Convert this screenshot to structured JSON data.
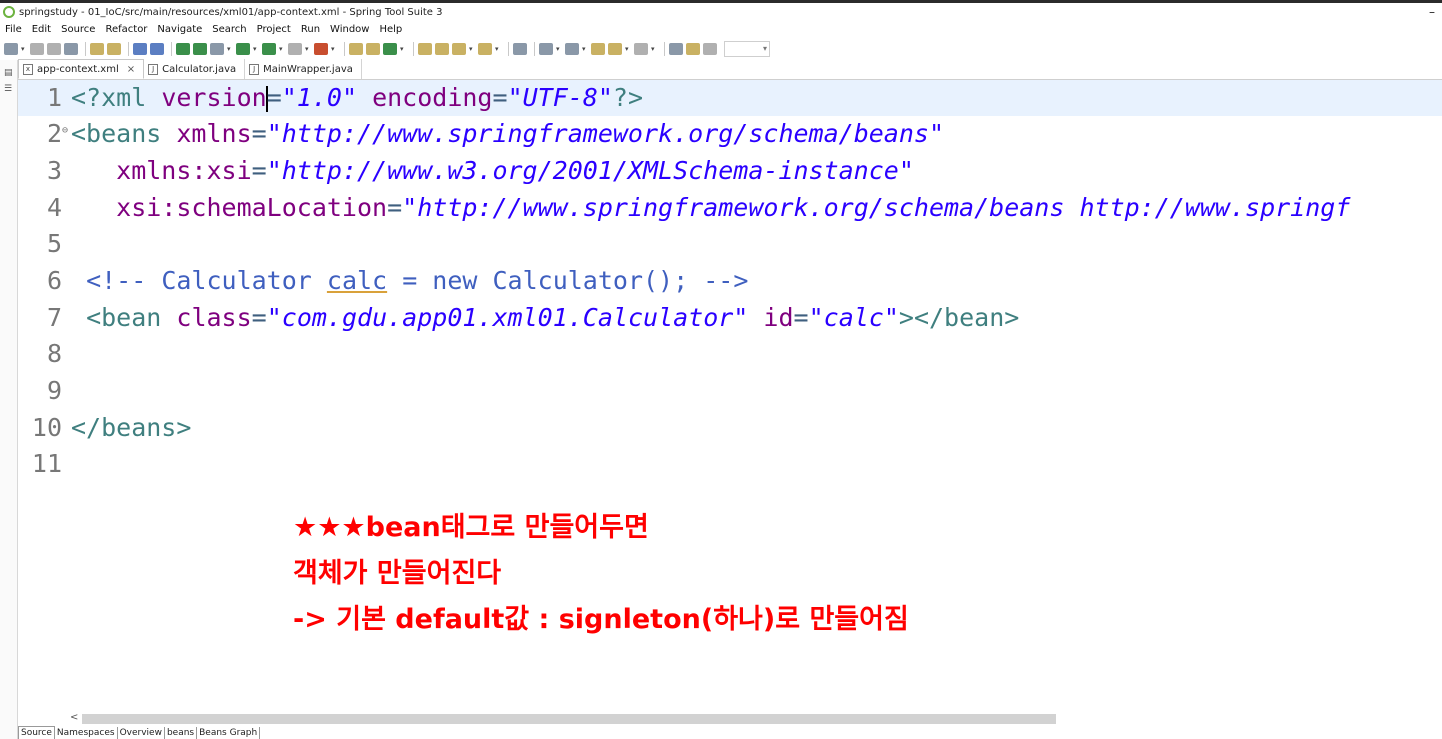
{
  "window": {
    "title": "springstudy - 01_IoC/src/main/resources/xml01/app-context.xml - Spring Tool Suite 3",
    "minimize": "–"
  },
  "menu": [
    "File",
    "Edit",
    "Source",
    "Refactor",
    "Navigate",
    "Search",
    "Project",
    "Run",
    "Window",
    "Help"
  ],
  "tabs": [
    {
      "label": "app-context.xml",
      "icon": "xml-file-icon",
      "active": true,
      "close": "×"
    },
    {
      "label": "Calculator.java",
      "icon": "java-file-icon",
      "active": false
    },
    {
      "label": "MainWrapper.java",
      "icon": "java-file-icon",
      "active": false
    }
  ],
  "editor": {
    "line_numbers": [
      "1",
      "2",
      "3",
      "4",
      "5",
      "6",
      "7",
      "8",
      "9",
      "10",
      "11"
    ],
    "line1": {
      "open": "<?xml",
      "attr1": "version",
      "eq1": "=",
      "val1": "\"1.0\"",
      "attr2": "encoding",
      "eq2": "=",
      "val2": "\"UTF-8\"",
      "close": "?>"
    },
    "line2": {
      "open": "<beans",
      "attr": "xmlns",
      "eq": "=",
      "val": "\"http://www.springframework.org/schema/beans\""
    },
    "line3": {
      "attr": "xmlns:xsi",
      "eq": "=",
      "val": "\"http://www.w3.org/2001/XMLSchema-instance\""
    },
    "line4": {
      "attr": "xsi:schemaLocation",
      "eq": "=",
      "val": "\"http://www.springframework.org/schema/beans http://www.springf"
    },
    "line6": {
      "open": "<!-- Calculator",
      "underlined": "calc",
      "rest": "= new Calculator(); -->"
    },
    "line7": {
      "open": "<bean",
      "attr1": "class",
      "eq1": "=",
      "val1": "\"com.gdu.app01.xml01.Calculator\"",
      "attr2": "id",
      "eq2": "=",
      "val2": "\"calc\"",
      "close": "></bean>"
    },
    "line10": {
      "close": "</beans>"
    }
  },
  "annotation": {
    "line1": "★★★bean태그로 만들어두면",
    "line2": "객체가 만들어진다",
    "line3": "-> 기본 default값 : signleton(하나)로 만들어짐",
    "color": "#ff0000"
  },
  "bottom_tabs": [
    "Source",
    "Namespaces",
    "Overview",
    "beans",
    "Beans Graph"
  ],
  "scroll_left": "<"
}
